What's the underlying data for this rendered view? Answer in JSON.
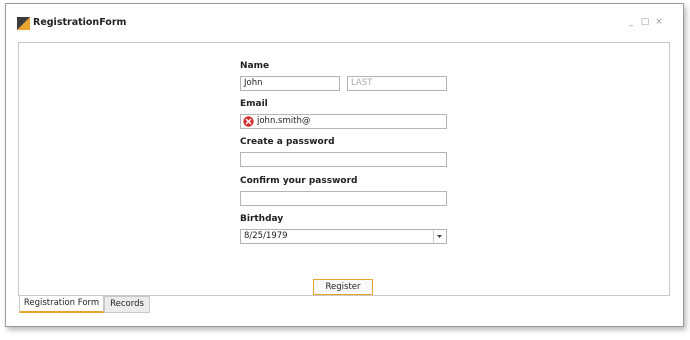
{
  "window": {
    "title": "RegistrationForm",
    "controls": {
      "minimize": "_",
      "maximize": "□",
      "close": "×"
    }
  },
  "form": {
    "name": {
      "label": "Name",
      "first_value": "John",
      "last_placeholder": "LAST"
    },
    "email": {
      "label": "Email",
      "value": "john.smith@",
      "status": "error",
      "error_icon": "error-x-icon"
    },
    "password": {
      "label": "Create a password",
      "value": ""
    },
    "confirm_password": {
      "label": "Confirm your password",
      "value": ""
    },
    "birthday": {
      "label": "Birthday",
      "value": "8/25/1979",
      "dropdown_icon": "chevron-down-icon"
    },
    "register_button": "Register"
  },
  "tabs": [
    {
      "label": "Registration Form",
      "active": true
    },
    {
      "label": "Records",
      "active": false
    }
  ],
  "colors": {
    "accent": "#e8a42f",
    "error": "#d32f2f",
    "border": "#b4b4b4"
  }
}
